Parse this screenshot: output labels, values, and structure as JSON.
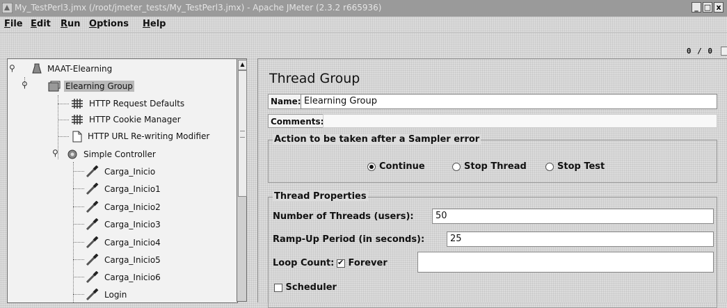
{
  "window": {
    "title": "My_TestPerl3.jmx (/root/jmeter_tests/My_TestPerl3.jmx) - Apache JMeter (2.3.2 r665936)",
    "minimize": "_",
    "maximize": "□",
    "close": "x"
  },
  "menu": {
    "items": [
      {
        "first": "F",
        "rest": "ile"
      },
      {
        "first": "E",
        "rest": "dit"
      },
      {
        "first": "R",
        "rest": "un"
      },
      {
        "first": "O",
        "rest": "ptions"
      },
      {
        "first": "H",
        "rest": "elp"
      }
    ]
  },
  "toolbar": {
    "thread_count": "0 / 0"
  },
  "tree": {
    "root": {
      "label": "MAAT-Elearning",
      "icon": "test-plan-icon"
    },
    "group": {
      "label": "Elearning Group",
      "icon": "thread-group-icon"
    },
    "config": [
      {
        "label": "HTTP Request Defaults",
        "icon": "config-icon"
      },
      {
        "label": "HTTP Cookie Manager",
        "icon": "config-icon"
      },
      {
        "label": "HTTP URL Re-writing Modifier",
        "icon": "document-icon"
      }
    ],
    "controller": {
      "label": "Simple Controller",
      "icon": "controller-icon"
    },
    "samplers": [
      {
        "label": "Carga_Inicio"
      },
      {
        "label": "Carga_Inicio1"
      },
      {
        "label": "Carga_Inicio2"
      },
      {
        "label": "Carga_Inicio3"
      },
      {
        "label": "Carga_Inicio4"
      },
      {
        "label": "Carga_Inicio5"
      },
      {
        "label": "Carga_Inicio6"
      },
      {
        "label": "Login"
      }
    ]
  },
  "panel": {
    "title": "Thread Group",
    "name_label": "Name:",
    "name_value": "Elearning Group",
    "comments_label": "Comments:",
    "action_legend": "Action to be taken after a Sampler error",
    "options": [
      "Continue",
      "Stop Thread",
      "Stop Test"
    ],
    "selected_option": "Continue",
    "props_legend": "Thread Properties",
    "threads_label": "Number of Threads (users):",
    "threads_value": "50",
    "rampup_label": "Ramp-Up Period (in seconds):",
    "rampup_value": "25",
    "loop_label": "Loop Count:",
    "forever_label": "Forever",
    "forever_checked": true,
    "loop_value": "",
    "scheduler_label": "Scheduler",
    "scheduler_checked": false
  }
}
